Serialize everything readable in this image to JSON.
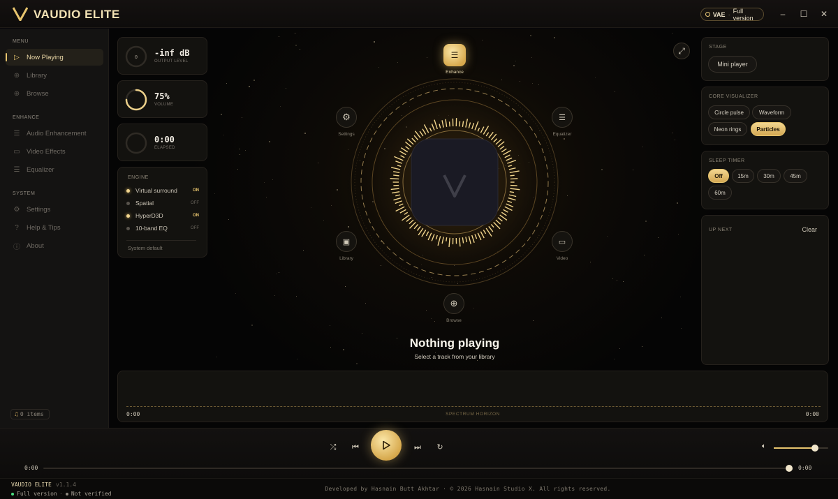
{
  "app": {
    "title": "VAUDIO ELITE",
    "license_code": "VAE",
    "license_label": "Full version"
  },
  "window": {
    "minimize": "–",
    "maximize": "☐",
    "close": "✕"
  },
  "sidebar": {
    "sections": [
      {
        "title": "MENU",
        "items": [
          {
            "label": "Now Playing",
            "icon": "play-icon",
            "active": true
          },
          {
            "label": "Library",
            "icon": "globe-icon"
          },
          {
            "label": "Browse",
            "icon": "globe-icon"
          }
        ]
      },
      {
        "title": "ENHANCE",
        "items": [
          {
            "label": "Audio Enhancement",
            "icon": "sliders-icon"
          },
          {
            "label": "Video Effects",
            "icon": "video-icon"
          },
          {
            "label": "Equalizer",
            "icon": "sliders-icon"
          }
        ]
      },
      {
        "title": "SYSTEM",
        "items": [
          {
            "label": "Settings",
            "icon": "gear-icon"
          },
          {
            "label": "Help & Tips",
            "icon": "question-icon"
          },
          {
            "label": "About",
            "icon": "info-icon"
          }
        ]
      }
    ],
    "queue_count": "0 items"
  },
  "meters": [
    {
      "value": "-inf dB",
      "label": "OUTPUT LEVEL",
      "ring_text": "0",
      "level": 0
    },
    {
      "value": "75%",
      "label": "VOLUME",
      "ring_text": "",
      "level": 0.75
    },
    {
      "value": "0:00",
      "label": "ELAPSED",
      "ring_text": "",
      "level": 0
    }
  ],
  "engine": {
    "title": "ENGINE",
    "rows": [
      {
        "label": "Virtual surround",
        "state": "ON",
        "on": true
      },
      {
        "label": "Spatial",
        "state": "OFF",
        "on": false
      },
      {
        "label": "HyperD3D",
        "state": "ON",
        "on": true
      },
      {
        "label": "10-band EQ",
        "state": "OFF",
        "on": false
      }
    ],
    "footer": "System default"
  },
  "orbit": {
    "enhance": "Enhance",
    "settings": "Settings",
    "equalizer": "Equalizer",
    "library": "Library",
    "video": "Video",
    "browse": "Browse"
  },
  "now_playing": {
    "title": "Nothing playing",
    "subtitle": "Select a track from your library"
  },
  "spectrum": {
    "label": "SPECTRUM HORIZON",
    "start": "0:00",
    "end": "0:00"
  },
  "stage_panel": {
    "title": "STAGE",
    "button": "Mini player"
  },
  "visualizer": {
    "title": "CORE VISUALIZER",
    "options": [
      "Circle pulse",
      "Waveform",
      "Neon rings",
      "Particles"
    ],
    "selected": "Particles"
  },
  "sleep": {
    "title": "SLEEP TIMER",
    "options": [
      "Off",
      "15m",
      "30m",
      "45m",
      "60m"
    ],
    "selected": "Off"
  },
  "up_next": {
    "title": "UP NEXT",
    "clear": "Clear"
  },
  "player": {
    "current": "0:00",
    "end": "0:00",
    "progress": 0.99,
    "volume": 0.75
  },
  "footer": {
    "name": "VAUDIO ELITE",
    "version": "v1.1.4",
    "status1": "Full version",
    "status2": "Not verified",
    "credit": "Developed by Hasnain Butt Akhtar · © 2026 Hasnain Studio X. All rights reserved."
  },
  "colors": {
    "accent": "#e8c56e",
    "background": "#07060a",
    "panel": "#161411"
  }
}
